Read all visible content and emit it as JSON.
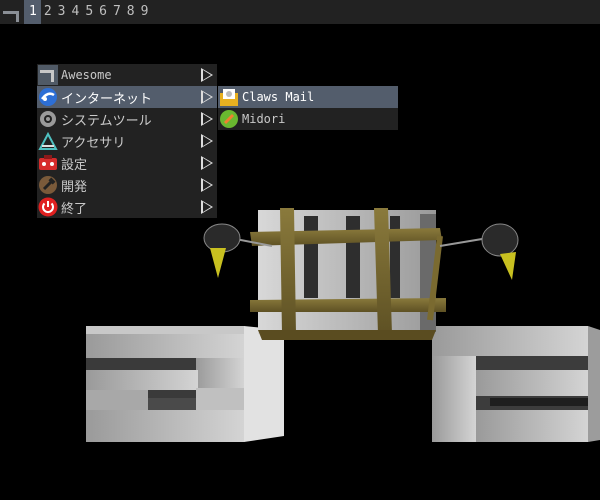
{
  "taglist": {
    "tags": [
      "1",
      "2",
      "3",
      "4",
      "5",
      "6",
      "7",
      "8",
      "9"
    ],
    "active_index": 0
  },
  "main_menu": {
    "items": [
      {
        "label": "Awesome",
        "icon": "awesome-icon"
      },
      {
        "label": "インターネット",
        "icon": "internet-icon",
        "focused": true
      },
      {
        "label": "システムツール",
        "icon": "system-tools-icon"
      },
      {
        "label": "アクセサリ",
        "icon": "accessories-icon"
      },
      {
        "label": "設定",
        "icon": "settings-icon"
      },
      {
        "label": "開発",
        "icon": "development-icon"
      },
      {
        "label": "終了",
        "icon": "power-icon"
      }
    ]
  },
  "submenu": {
    "items": [
      {
        "label": "Claws Mail",
        "icon": "mail-icon",
        "focused": true
      },
      {
        "label": "Midori",
        "icon": "midori-icon"
      }
    ]
  },
  "colors": {
    "bar_bg": "#222222",
    "focus_bg": "#535d6c",
    "desktop_bg": "#000000"
  }
}
